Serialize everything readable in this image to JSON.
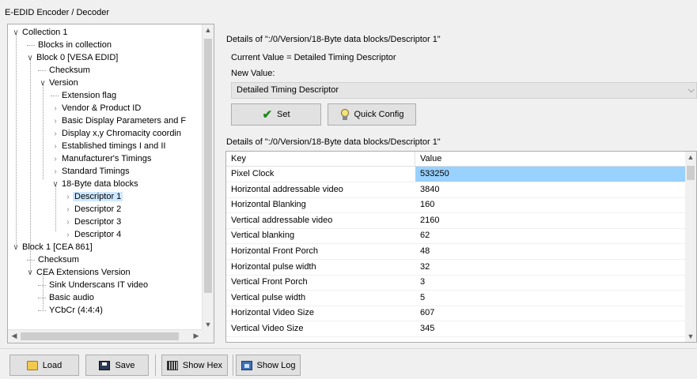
{
  "window": {
    "title": "E-EDID Encoder / Decoder"
  },
  "tree": {
    "nodes": [
      {
        "label": "Collection 1",
        "expander": "expanded"
      },
      {
        "label": "Blocks in collection",
        "expander": ""
      },
      {
        "label": "Block 0 [VESA EDID]",
        "expander": "expanded"
      },
      {
        "label": "Checksum",
        "expander": ""
      },
      {
        "label": "Version",
        "expander": "expanded"
      },
      {
        "label": "Extension flag",
        "expander": ""
      },
      {
        "label": "Vendor & Product ID",
        "expander": "collapsed"
      },
      {
        "label": "Basic Display Parameters and F",
        "expander": "collapsed"
      },
      {
        "label": "Display x,y Chromacity coordin",
        "expander": "collapsed"
      },
      {
        "label": "Established timings I and II",
        "expander": "collapsed"
      },
      {
        "label": "Manufacturer's Timings",
        "expander": "collapsed"
      },
      {
        "label": "Standard Timings",
        "expander": "collapsed"
      },
      {
        "label": "18-Byte data blocks",
        "expander": "expanded"
      },
      {
        "label": "Descriptor 1",
        "expander": "collapsed",
        "selected": true
      },
      {
        "label": "Descriptor 2",
        "expander": "collapsed"
      },
      {
        "label": "Descriptor 3",
        "expander": "collapsed"
      },
      {
        "label": "Descriptor 4",
        "expander": "collapsed"
      },
      {
        "label": "Block 1 [CEA 861]",
        "expander": "expanded"
      },
      {
        "label": "Checksum",
        "expander": ""
      },
      {
        "label": "CEA Extensions Version",
        "expander": "expanded"
      },
      {
        "label": "Sink Underscans IT video",
        "expander": ""
      },
      {
        "label": "Basic audio",
        "expander": ""
      },
      {
        "label": "YCbCr (4:4:4)",
        "expander": ""
      }
    ]
  },
  "details": {
    "header": "Details of \":/0/Version/18-Byte data blocks/Descriptor 1\"",
    "current_value": "Current Value = Detailed Timing Descriptor",
    "new_value_label": "New Value:",
    "new_value_selected": "Detailed Timing Descriptor",
    "set_label": "Set",
    "quick_config_label": "Quick Config",
    "table_header": "Details of \":/0/Version/18-Byte data blocks/Descriptor 1\""
  },
  "table": {
    "columns": [
      "Key",
      "Value"
    ],
    "rows": [
      [
        "Pixel Clock",
        "533250"
      ],
      [
        "Horizontal addressable video",
        "3840"
      ],
      [
        "Horizontal Blanking",
        "160"
      ],
      [
        "Vertical addressable video",
        "2160"
      ],
      [
        "Vertical blanking",
        "62"
      ],
      [
        "Horizontal Front Porch",
        "48"
      ],
      [
        "Horizontal pulse width",
        "32"
      ],
      [
        "Vertical Front Porch",
        "3"
      ],
      [
        "Vertical pulse width",
        "5"
      ],
      [
        "Horizontal Video Size",
        "607"
      ],
      [
        "Vertical Video Size",
        "345"
      ]
    ]
  },
  "toolbar": {
    "load_label": "Load",
    "save_label": "Save",
    "show_hex_label": "Show Hex",
    "show_log_label": "Show Log"
  },
  "icons": {
    "set": "check-icon",
    "quick_config": "bulb-icon",
    "load": "folder-icon",
    "save": "floppy-icon",
    "show_hex": "hex-icon",
    "show_log": "log-icon"
  },
  "colors": {
    "selection": "#cce8ff",
    "table_selection": "#99d1ff"
  }
}
